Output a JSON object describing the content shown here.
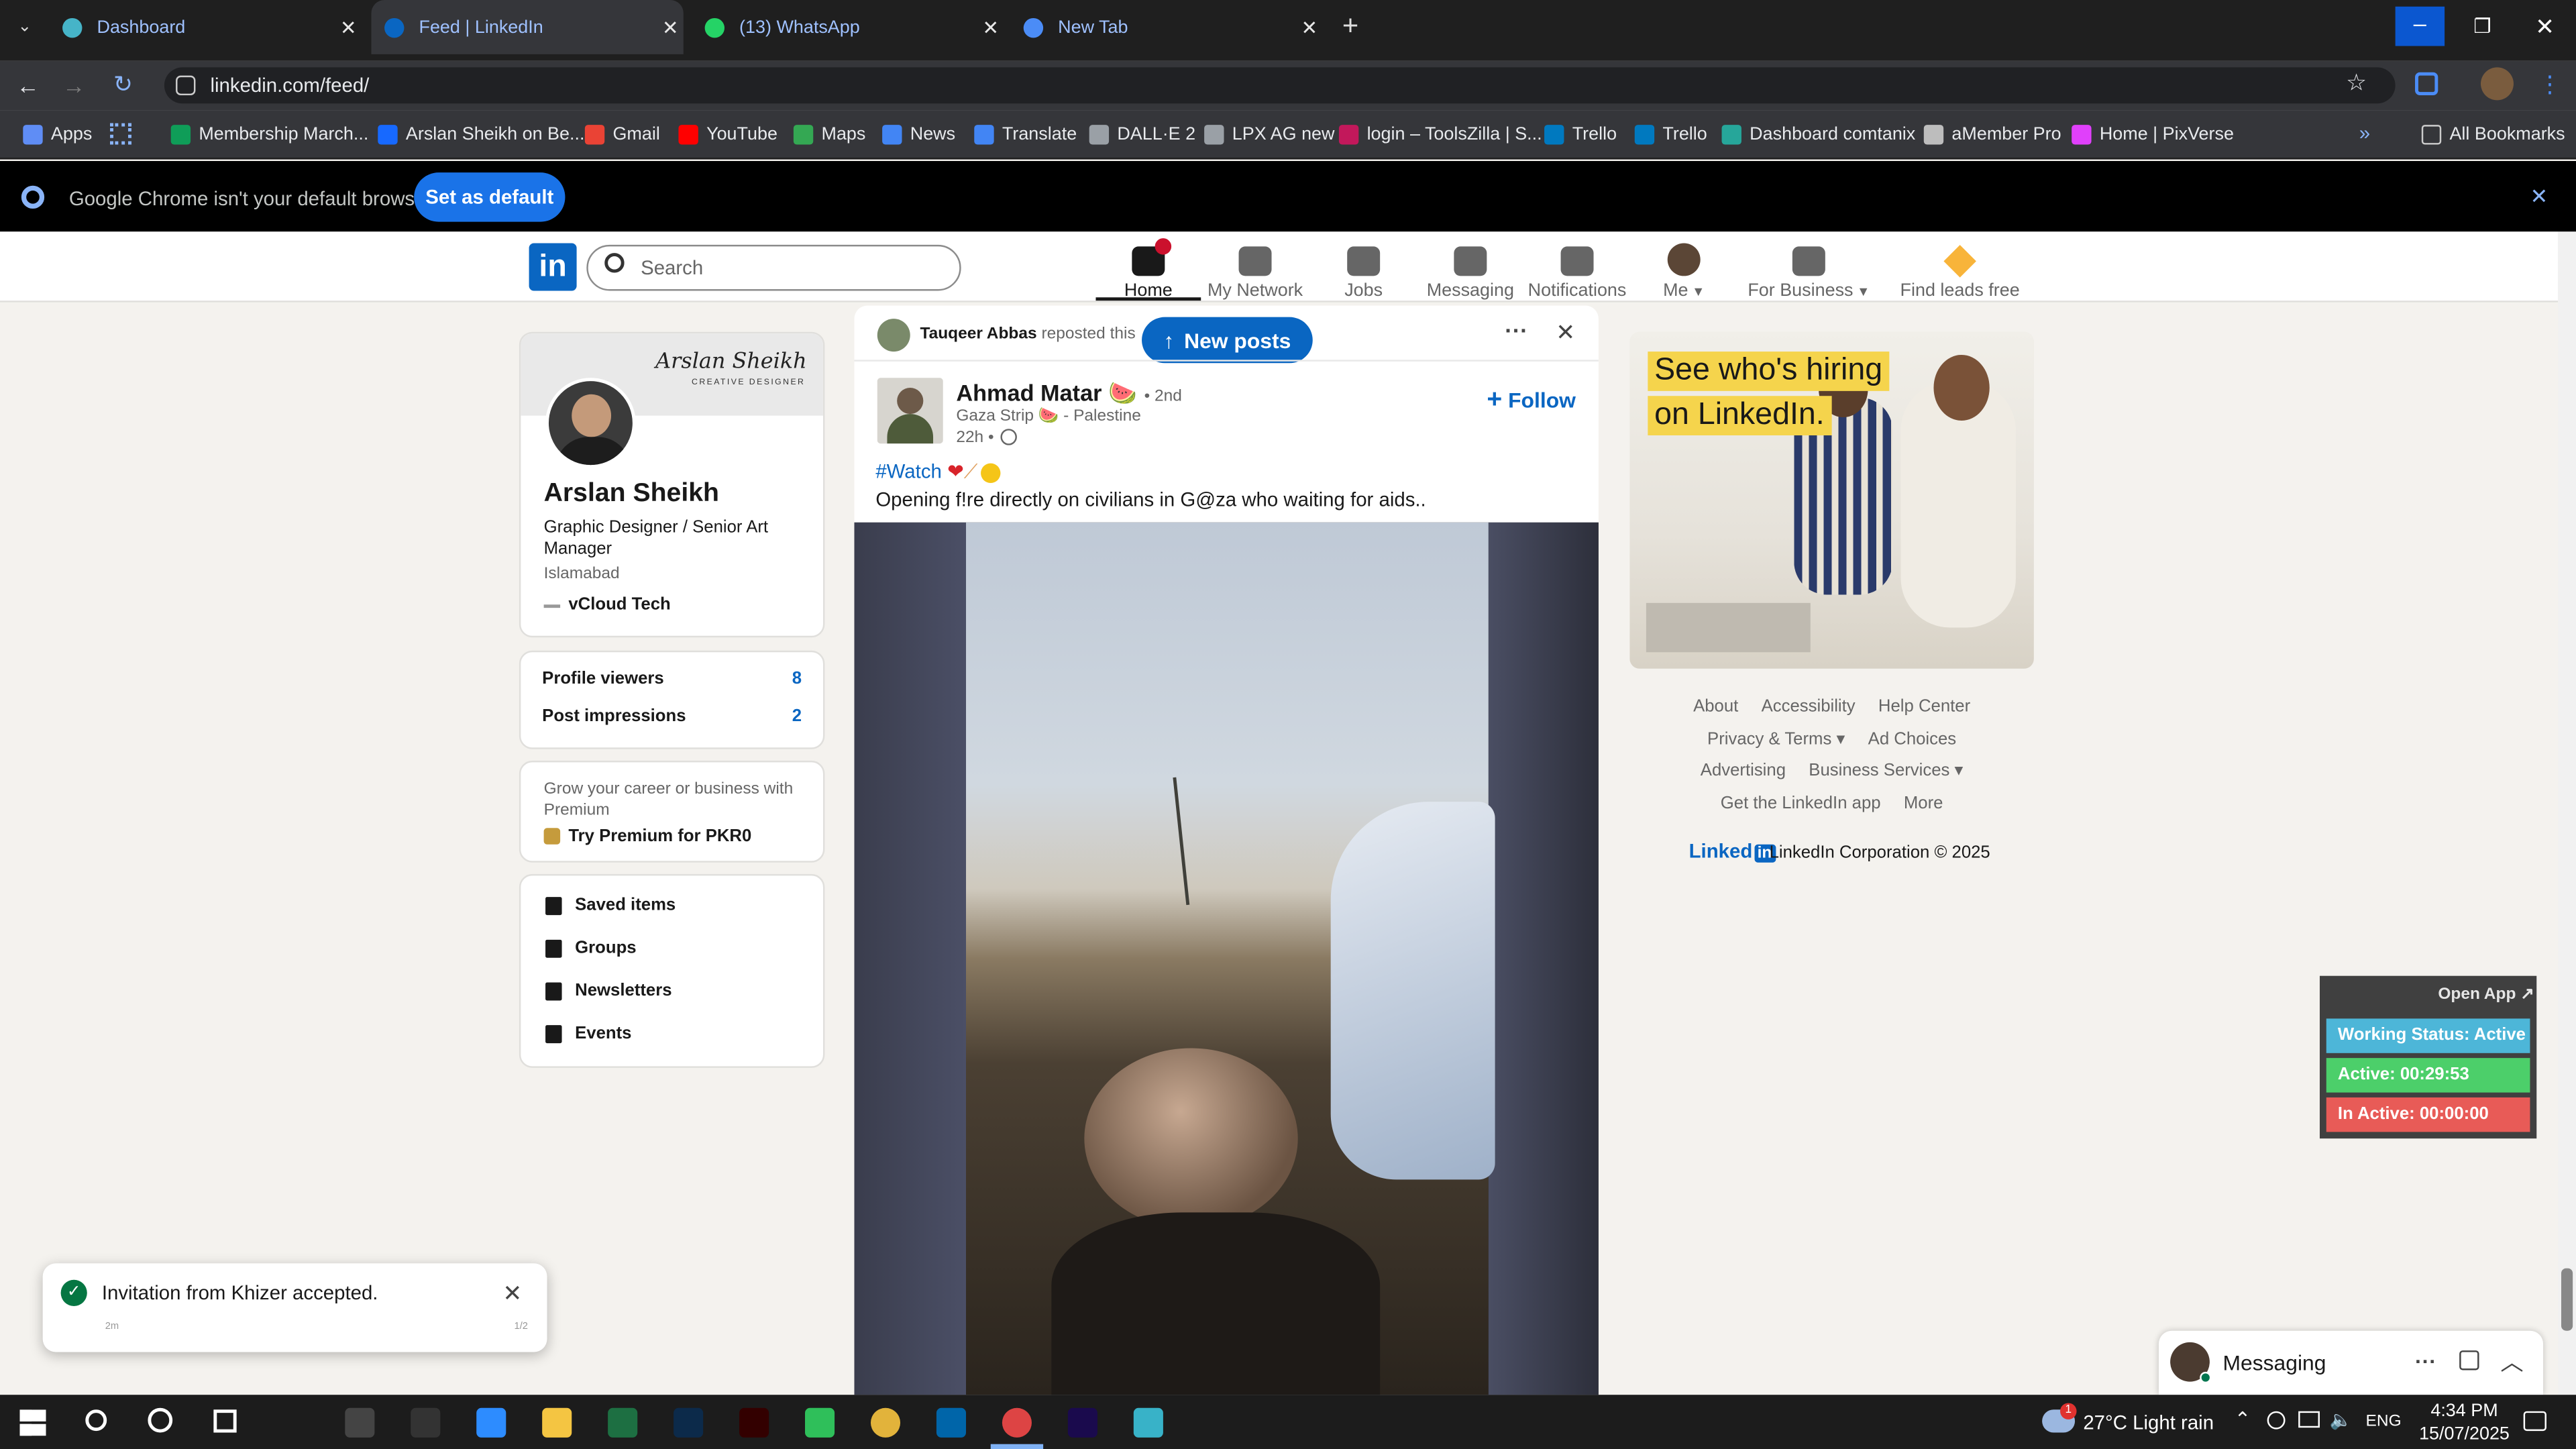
{
  "browser": {
    "tabs": [
      {
        "title": "Dashboard",
        "icon": "dashboard-icon"
      },
      {
        "title": "Feed | LinkedIn",
        "icon": "linkedin-icon"
      },
      {
        "title": "(13) WhatsApp",
        "icon": "whatsapp-icon"
      },
      {
        "title": "New Tab",
        "icon": "chrome-icon"
      }
    ],
    "url": "linkedin.com/feed/",
    "bookmarks": [
      {
        "label": "Apps",
        "color": "#5f8df5"
      },
      {
        "label": "Membership March...",
        "color": "#0f9d58"
      },
      {
        "label": "Arslan Sheikh on Be...",
        "color": "#1769ff"
      },
      {
        "label": "Gmail",
        "color": "#ea4335"
      },
      {
        "label": "YouTube",
        "color": "#ff0000"
      },
      {
        "label": "Maps",
        "color": "#34a853"
      },
      {
        "label": "News",
        "color": "#4285f4"
      },
      {
        "label": "Translate",
        "color": "#4285f4"
      },
      {
        "label": "DALL·E 2",
        "color": "#9aa0a6"
      },
      {
        "label": "LPX AG new",
        "color": "#9aa0a6"
      },
      {
        "label": "login – ToolsZilla | S...",
        "color": "#c2185b"
      },
      {
        "label": "Trello",
        "color": "#0079bf"
      },
      {
        "label": "Trello",
        "color": "#0079bf"
      },
      {
        "label": "Dashboard comtanix",
        "color": "#26a69a"
      },
      {
        "label": "aMember Pro",
        "color": "#bdbdbd"
      },
      {
        "label": "Home | PixVerse",
        "color": "#e040fb"
      }
    ],
    "all_bookmarks": "All Bookmarks",
    "infobar": {
      "message": "Google Chrome isn't your default browser",
      "button": "Set as default"
    }
  },
  "linkedin": {
    "search_placeholder": "Search",
    "nav": [
      {
        "label": "Home",
        "icon": "home-icon"
      },
      {
        "label": "My Network",
        "icon": "network-icon"
      },
      {
        "label": "Jobs",
        "icon": "jobs-icon"
      },
      {
        "label": "Messaging",
        "icon": "messaging-icon"
      },
      {
        "label": "Notifications",
        "icon": "bell-icon"
      },
      {
        "label": "Me",
        "icon": "avatar"
      },
      {
        "label": "For Business",
        "icon": "grid-icon"
      },
      {
        "label": "Find leads free",
        "icon": "leads-icon"
      }
    ],
    "profile": {
      "banner_title": "Arslan Sheikh",
      "banner_sub": "CREATIVE DESIGNER",
      "name": "Arslan Sheikh",
      "headline": "Graphic Designer / Senior Art Manager",
      "location": "Islamabad",
      "company": "vCloud Tech"
    },
    "stats": [
      {
        "label": "Profile viewers",
        "value": "8"
      },
      {
        "label": "Post impressions",
        "value": "2"
      }
    ],
    "premium": {
      "text": "Grow your career or business with Premium",
      "cta": "Try Premium for PKR0"
    },
    "shortcuts": [
      {
        "label": "Saved items",
        "icon": "bookmark-icon"
      },
      {
        "label": "Groups",
        "icon": "groups-icon"
      },
      {
        "label": "Newsletters",
        "icon": "newsletter-icon"
      },
      {
        "label": "Events",
        "icon": "calendar-icon"
      }
    ],
    "post": {
      "reposter": "Tauqeer Abbas",
      "reposted": "reposted this",
      "new_posts": "New posts",
      "author": "Ahmad Matar 🍉",
      "degree": "• 2nd",
      "subtitle": "Gaza Strip 🍉 - Palestine",
      "time": "22h •",
      "follow": "Follow",
      "hashtag": "#Watch",
      "text": "Opening f!re directly on civilians in G@za who waiting for aids.."
    },
    "ad": {
      "line1": "See who's hiring",
      "line2": "on LinkedIn."
    },
    "footer": [
      [
        "About",
        "Accessibility",
        "Help Center"
      ],
      [
        "Privacy & Terms ▾",
        "Ad Choices"
      ],
      [
        "Advertising",
        "Business Services ▾"
      ],
      [
        "Get the LinkedIn app",
        "More"
      ]
    ],
    "copyright_logo": "Linked",
    "copyright": "LinkedIn Corporation © 2025",
    "toast": {
      "text": "Invitation from Khizer accepted.",
      "time": "2m",
      "page": "1/2"
    },
    "messaging": "Messaging"
  },
  "work_tracker": {
    "open_app": "Open App ↗",
    "status": "Working Status: Active",
    "active": "Active: 00:29:53",
    "inactive": "In Active: 00:00:00",
    "colors": {
      "status": "#4db6d8",
      "active": "#4ccf6a",
      "inactive": "#e85b57"
    }
  },
  "taskbar": {
    "weather": "27°C Light rain",
    "lang": "ENG",
    "time": "4:34 PM",
    "date": "15/07/2025",
    "weather_badge": "1"
  }
}
